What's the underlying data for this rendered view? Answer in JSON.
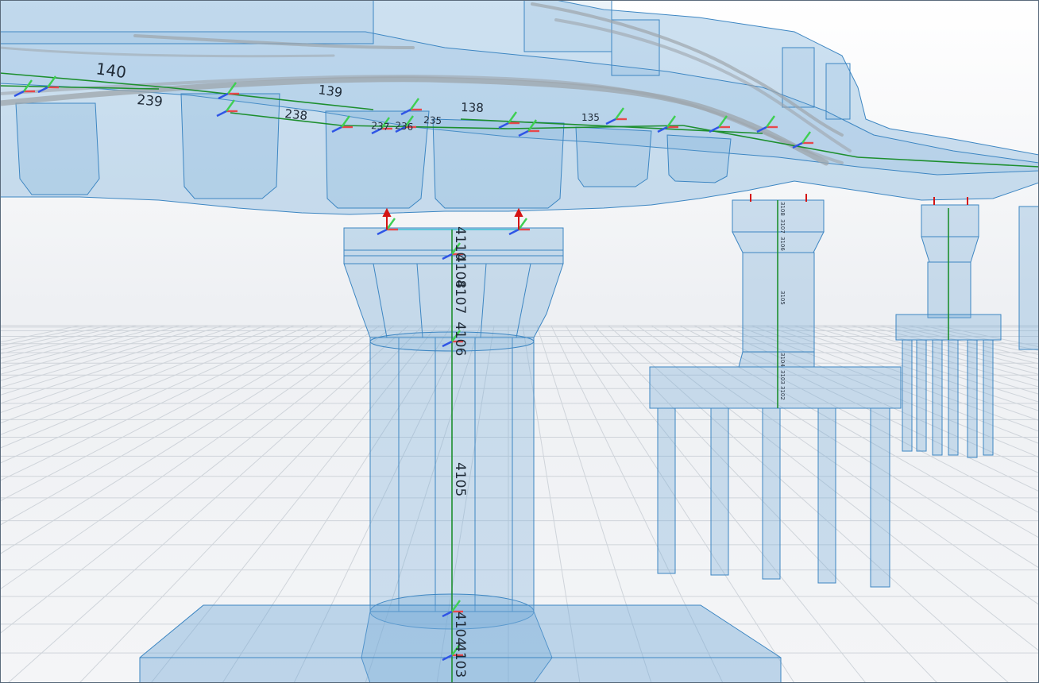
{
  "scene": {
    "colors": {
      "concrete_fill": "#6fa8d6",
      "concrete_edge": "#3d86c2",
      "member_line": "#1d8f2e",
      "tendon": "#9ea5ab",
      "axis_x": "#e8474b",
      "axis_y": "#3ecf52",
      "axis_z": "#2f55e6",
      "support_arrow": "#d41414",
      "grid_line": "#cfd4da"
    },
    "deck_member_labels": [
      "140",
      "239",
      "238",
      "139",
      "237",
      "236",
      "235",
      "138",
      "135"
    ],
    "front_pier_labels": [
      "4110",
      "4108",
      "4107",
      "4106",
      "4105",
      "4104",
      "4103"
    ],
    "middle_pier_labels": [
      "3108",
      "3107",
      "3106",
      "3105",
      "3104",
      "3103",
      "3102"
    ]
  }
}
